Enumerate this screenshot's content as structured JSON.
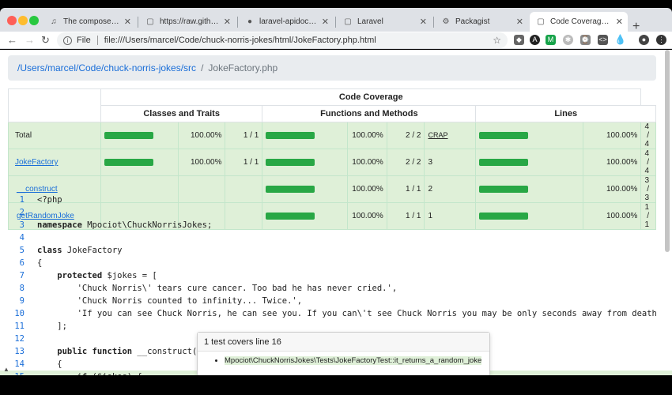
{
  "browser": {
    "tabs": [
      {
        "title": "The composer.json S",
        "icon": "composer-icon"
      },
      {
        "title": "https://raw.githubuse",
        "icon": "page-icon"
      },
      {
        "title": "laravel-apidoc-gener",
        "icon": "github-icon"
      },
      {
        "title": "Laravel",
        "icon": "page-icon"
      },
      {
        "title": "Packagist",
        "icon": "packagist-icon"
      },
      {
        "title": "Code Coverage for /L",
        "icon": "page-icon"
      }
    ],
    "scheme": "File",
    "url": "file:///Users/marcel/Code/chuck-norris-jokes/html/JokeFactory.php.html"
  },
  "breadcrumb": {
    "path": "/Users/marcel/Code/chuck-norris-jokes/src",
    "current": "JokeFactory.php"
  },
  "coverage": {
    "title": "Code Coverage",
    "groups": [
      "Classes and Traits",
      "Functions and Methods",
      "Lines"
    ],
    "rows": [
      {
        "name": "Total",
        "link": false,
        "classes_pct": "100.00%",
        "classes_cnt": "1 / 1",
        "func_pct": "100.00%",
        "func_cnt": "2 / 2",
        "crap": "CRAP",
        "lines_pct": "100.00%",
        "lines_cnt": "4 / 4"
      },
      {
        "name": "JokeFactory",
        "link": true,
        "classes_pct": "100.00%",
        "classes_cnt": "1 / 1",
        "func_pct": "100.00%",
        "func_cnt": "2 / 2",
        "crap": "3",
        "lines_pct": "100.00%",
        "lines_cnt": "4 / 4"
      },
      {
        "name": "__construct",
        "link": true,
        "classes_pct": "",
        "classes_cnt": "",
        "func_pct": "100.00%",
        "func_cnt": "1 / 1",
        "crap": "2",
        "lines_pct": "100.00%",
        "lines_cnt": "3 / 3"
      },
      {
        "name": "getRandomJoke",
        "link": true,
        "classes_pct": "",
        "classes_cnt": "",
        "func_pct": "100.00%",
        "func_cnt": "1 / 1",
        "crap": "1",
        "lines_pct": "100.00%",
        "lines_cnt": "1 / 1"
      }
    ],
    "bar_fill_fraction": 1.0,
    "color_success": "#28a745",
    "color_row": "#dff0d8"
  },
  "code_lines": [
    {
      "n": "1",
      "text": "<?php"
    },
    {
      "n": "2",
      "text": ""
    },
    {
      "n": "3",
      "kw": "namespace",
      "text": " Mpociot\\ChuckNorrisJokes;"
    },
    {
      "n": "4",
      "text": ""
    },
    {
      "n": "5",
      "kw": "class",
      "text": " JokeFactory"
    },
    {
      "n": "6",
      "text": "{"
    },
    {
      "n": "7",
      "kw": "    protected",
      "text": " $jokes = ["
    },
    {
      "n": "8",
      "text": "        'Chuck Norris\\' tears cure cancer. Too bad he has never cried.',"
    },
    {
      "n": "9",
      "text": "        'Chuck Norris counted to infinity... Twice.',"
    },
    {
      "n": "10",
      "text": "        'If you can see Chuck Norris, he can see you. If you can\\'t see Chuck Norris you may be only seconds away from death"
    },
    {
      "n": "11",
      "text": "    ];"
    },
    {
      "n": "12",
      "text": ""
    },
    {
      "n": "13",
      "kw": "    public function",
      "text": " __construct("
    },
    {
      "n": "14",
      "text": "    {"
    },
    {
      "n": "15",
      "text": "        if ($jokes) {"
    }
  ],
  "popover": {
    "title": "1 test covers line 16",
    "tests": [
      "Mpociot\\ChuckNorrisJokes\\Tests\\JokeFactoryTest::it_returns_a_random_joke"
    ]
  }
}
